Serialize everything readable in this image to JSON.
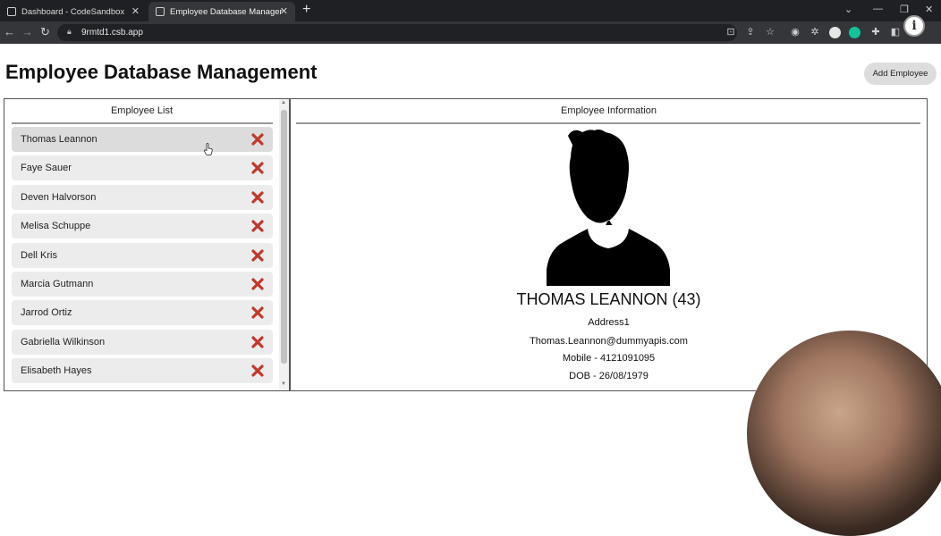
{
  "browser": {
    "tabs": [
      {
        "title": "Dashboard - CodeSandbox",
        "active": false
      },
      {
        "title": "Employee Database Manager",
        "active": true
      }
    ],
    "url": "9rmtd1.csb.app"
  },
  "app": {
    "title": "Employee Database Management",
    "add_button_label": "Add Employee"
  },
  "employee_list": {
    "header": "Employee List",
    "selected_index": 0,
    "items": [
      {
        "name": "Thomas Leannon"
      },
      {
        "name": "Faye Sauer"
      },
      {
        "name": "Deven Halvorson"
      },
      {
        "name": "Melisa Schuppe"
      },
      {
        "name": "Dell Kris"
      },
      {
        "name": "Marcia Gutmann"
      },
      {
        "name": "Jarrod Ortiz"
      },
      {
        "name": "Gabriella Wilkinson"
      },
      {
        "name": "Elisabeth Hayes"
      }
    ]
  },
  "employee_info": {
    "header": "Employee Information",
    "name_age": "THOMAS LEANNON (43)",
    "address": "Address1",
    "email": "Thomas.Leannon@dummyapis.com",
    "mobile": "Mobile - 4121091095",
    "dob": "DOB - 26/08/1979"
  },
  "colors": {
    "delete_icon": "#c0392b",
    "avatar": "#000000"
  }
}
